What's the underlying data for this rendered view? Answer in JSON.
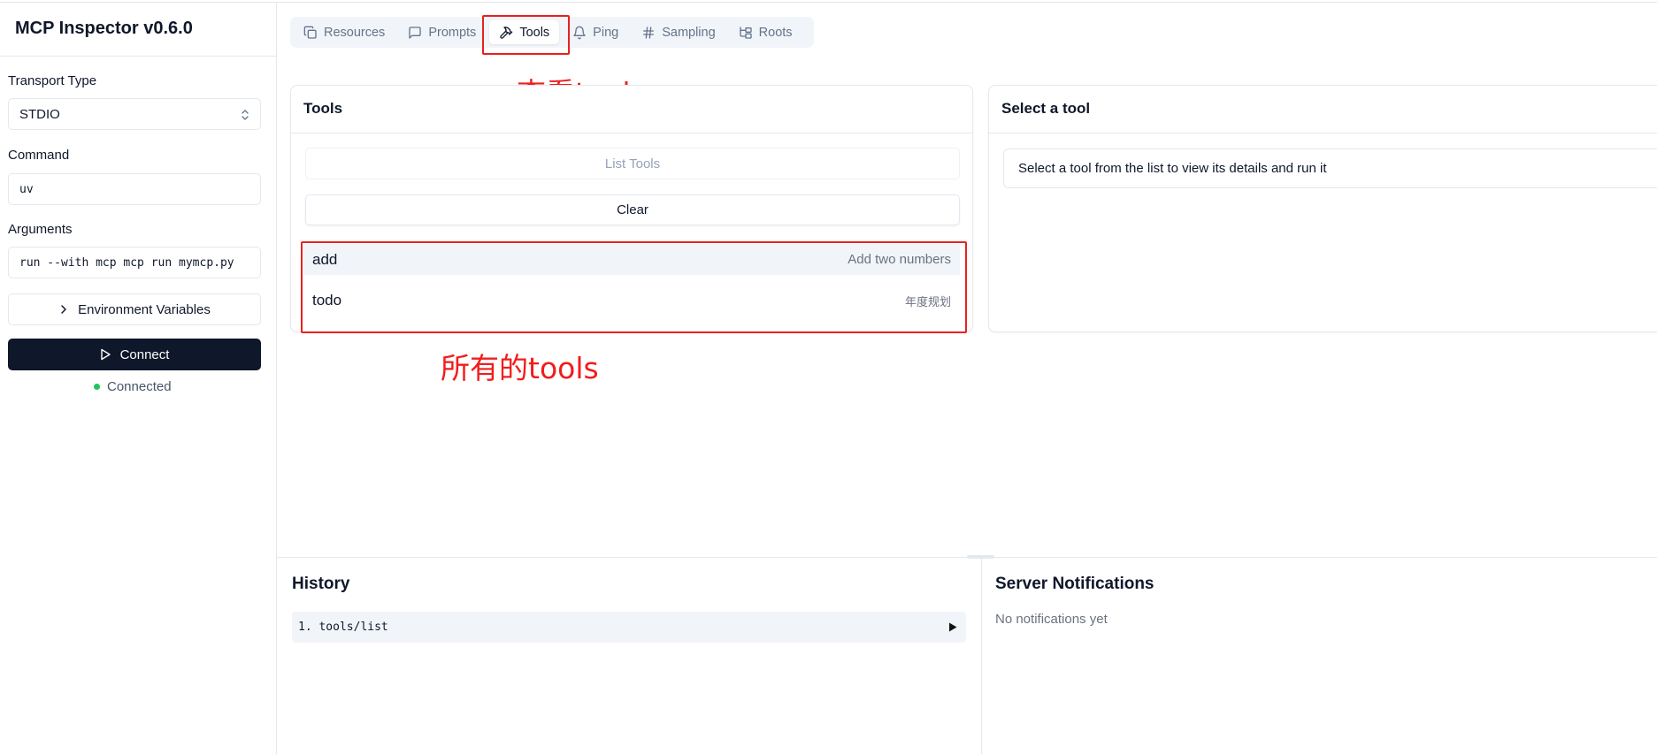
{
  "app": {
    "title": "MCP Inspector v0.6.0"
  },
  "sidebar": {
    "transport_label": "Transport Type",
    "transport_value": "STDIO",
    "transport_icon": "chevrons-up-down-icon",
    "command_label": "Command",
    "command_value": "uv",
    "arguments_label": "Arguments",
    "arguments_value": "run --with mcp mcp run mymcp.py",
    "env_button": "Environment Variables",
    "env_icon": "chevron-right-icon",
    "connect_button": "Connect",
    "connect_icon": "play-icon",
    "status": "Connected",
    "status_color": "#22c55e"
  },
  "tabs": [
    {
      "label": "Resources",
      "icon": "files-icon"
    },
    {
      "label": "Prompts",
      "icon": "message-square-icon"
    },
    {
      "label": "Tools",
      "icon": "hammer-icon",
      "active": true
    },
    {
      "label": "Ping",
      "icon": "bell-icon"
    },
    {
      "label": "Sampling",
      "icon": "hash-icon"
    },
    {
      "label": "Roots",
      "icon": "folder-tree-icon"
    }
  ],
  "annotations": {
    "tools_tab": "查看tool",
    "tools_list": "所有的tools",
    "color": "#f21c1c"
  },
  "tools_panel": {
    "title": "Tools",
    "list_button": "List Tools",
    "clear_button": "Clear",
    "items": [
      {
        "name": "add",
        "description": "Add two numbers"
      },
      {
        "name": "todo",
        "description": "年度规划"
      }
    ]
  },
  "detail_panel": {
    "title": "Select a tool",
    "message": "Select a tool from the list to view its details and run it"
  },
  "history": {
    "title": "History",
    "items": [
      {
        "label": "1. tools/list",
        "icon": "expand-arrow-icon"
      }
    ]
  },
  "notifications": {
    "title": "Server Notifications",
    "empty": "No notifications yet"
  }
}
